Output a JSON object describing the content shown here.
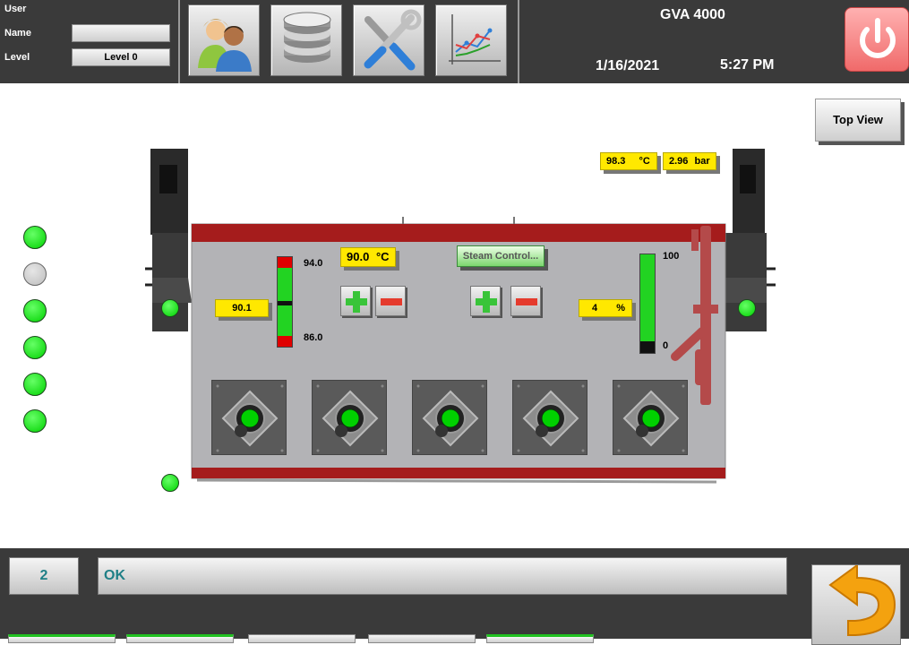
{
  "header": {
    "user_label": "User",
    "name_label": "Name",
    "name_value": "",
    "level_label": "Level",
    "level_value": "Level 0",
    "title": "GVA 4000",
    "date": "1/16/2021",
    "time": "5:27 PM",
    "nav_buttons": [
      "users-icon",
      "database-icon",
      "tools-icon",
      "trend-chart-icon"
    ]
  },
  "view": {
    "top_view_label": "Top View",
    "steam_temp": "98.3",
    "steam_temp_unit": "°C",
    "steam_pressure": "2.96",
    "steam_pressure_unit": "bar",
    "current_temp": "90.1",
    "setpoint_temp": "90.0",
    "setpoint_unit": "°C",
    "temp_scale_max": "94.0",
    "temp_scale_min": "86.0",
    "temp_bar_level": 0.51,
    "steam_control_label": "Steam Control...",
    "steam_percent": "4",
    "steam_percent_unit": "%",
    "steam_scale_max": "100",
    "steam_scale_min": "0",
    "steam_bar_level": 0.04,
    "side_indicators": [
      "on",
      "off",
      "on",
      "on",
      "on",
      "on"
    ],
    "burner_count": 5
  },
  "colors": {
    "indicator_on": "#00d100",
    "indicator_off": "#c8c8c8",
    "label_bg": "#ffe800",
    "oven_stripe": "#a51c1c",
    "status_text": "#1e7f86"
  },
  "footer": {
    "alarm_count": "2",
    "alarm_message": "OK",
    "back_icon": "orange-return-arrow-icon"
  }
}
